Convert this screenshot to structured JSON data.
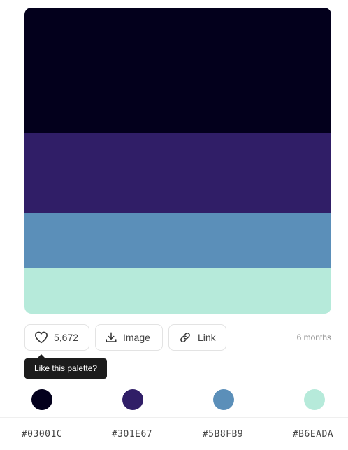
{
  "palette": {
    "colors": [
      "#03001C",
      "#301E67",
      "#5B8FB9",
      "#B6EADA"
    ],
    "bands": [
      {
        "color": "#03001C",
        "share": 0.41
      },
      {
        "color": "#301E67",
        "share": 0.26
      },
      {
        "color": "#5B8FB9",
        "share": 0.18
      },
      {
        "color": "#B6EADA",
        "share": 0.15
      }
    ]
  },
  "actions": {
    "like_count": "5,672",
    "image_label": "Image",
    "link_label": "Link",
    "age": "6 months"
  },
  "tooltip": {
    "text": "Like this palette?"
  },
  "codes": [
    "#03001C",
    "#301E67",
    "#5B8FB9",
    "#B6EADA"
  ],
  "icons": {
    "like": "heart-icon",
    "image": "download-icon",
    "link": "link-icon"
  }
}
